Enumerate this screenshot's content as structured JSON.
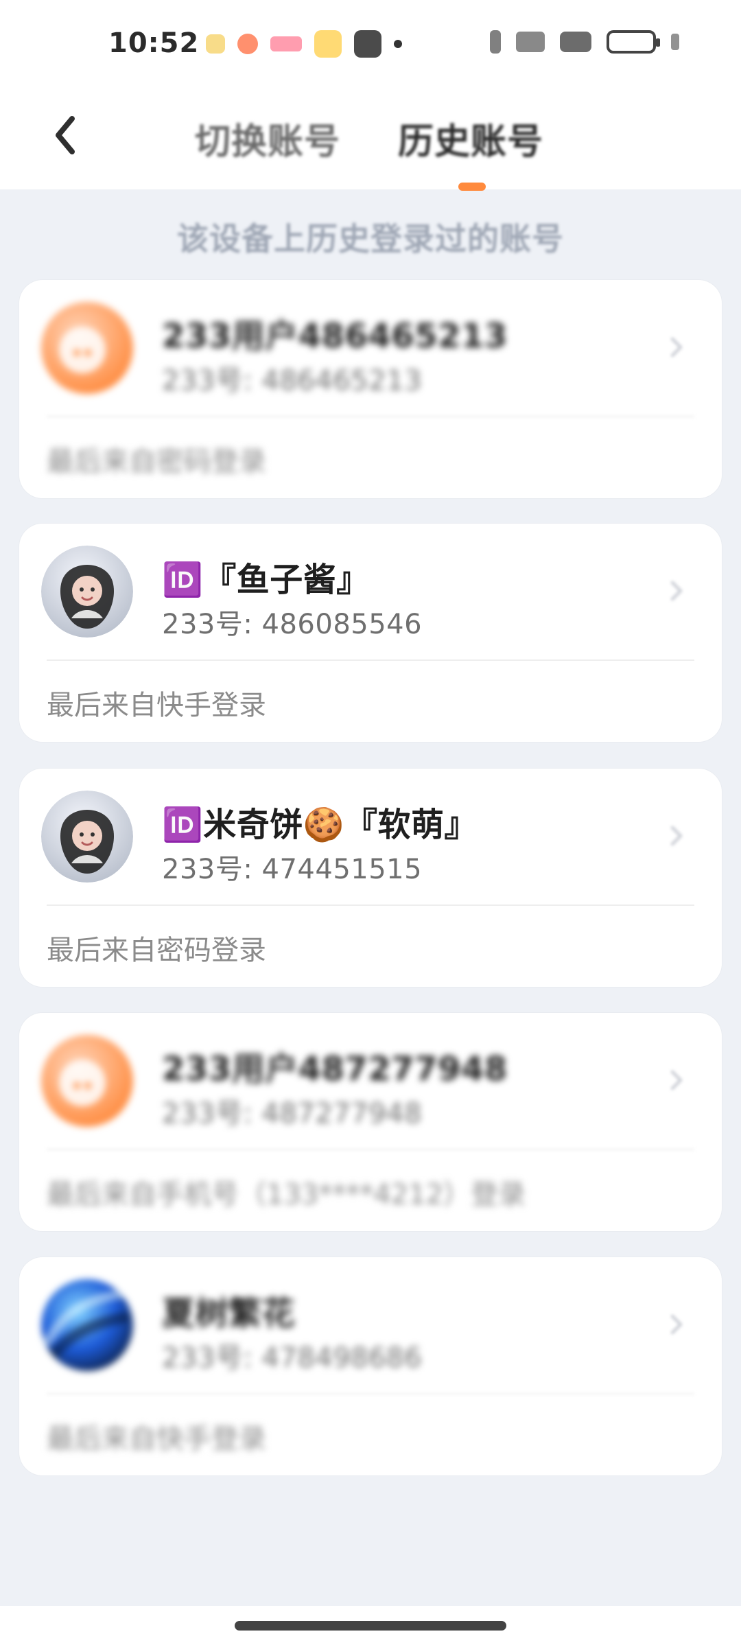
{
  "status_bar": {
    "time": "10:52"
  },
  "header": {
    "tabs": [
      {
        "label": "切换账号",
        "active": false
      },
      {
        "label": "历史账号",
        "active": true
      }
    ]
  },
  "subtitle": "该设备上历史登录过的账号",
  "accounts": [
    {
      "name": "233用户486465213",
      "uid_label": "233号: 486465213",
      "last_login": "最后来自密码登录",
      "avatar": {
        "type": "default",
        "bg": "#ffb58a",
        "accent": "#ff8a3d"
      }
    },
    {
      "name": "🆔『鱼子酱』",
      "uid_label": "233号: 486085546",
      "last_login": "最后来自快手登录",
      "avatar": {
        "type": "photo",
        "bg": "#d9dde6"
      }
    },
    {
      "name": "🆔米奇饼🍪『软萌』",
      "uid_label": "233号: 474451515",
      "last_login": "最后来自密码登录",
      "avatar": {
        "type": "photo",
        "bg": "#d9dde6"
      }
    },
    {
      "name": "233用户487277948",
      "uid_label": "233号: 487277948",
      "last_login": "最后来自手机号（133****4212）登录",
      "avatar": {
        "type": "default",
        "bg": "#ffb58a",
        "accent": "#ff8a3d"
      }
    },
    {
      "name": "夏树繁花",
      "uid_label": "233号: 478498686",
      "last_login": "最后来自快手登录",
      "avatar": {
        "type": "photo",
        "bg": "#1d5bd8"
      }
    }
  ]
}
